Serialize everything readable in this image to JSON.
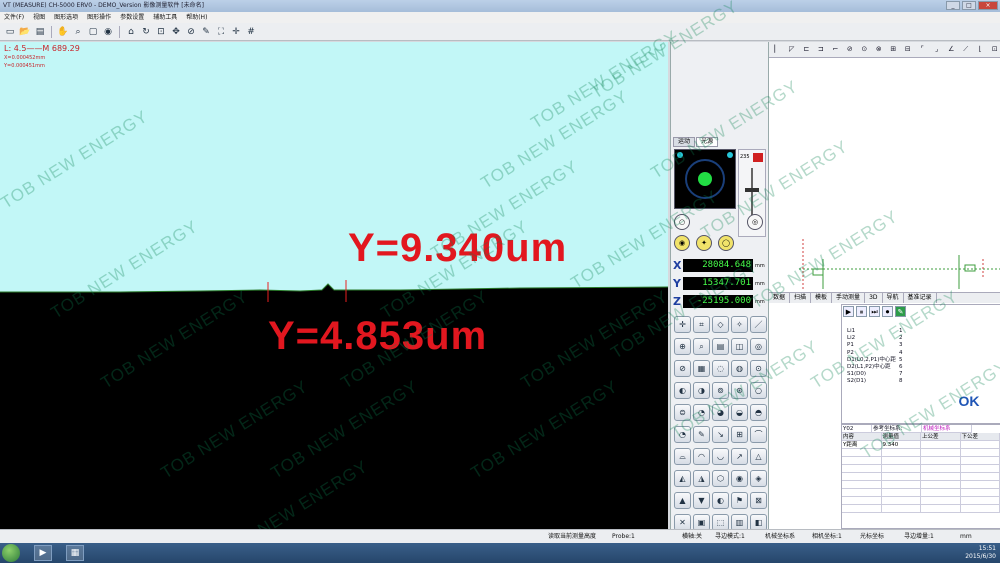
{
  "window": {
    "title": "VT (MEASURE) CH-5000 ERV0 - DEMO_Version 影像测量软件 [未命名]",
    "controls": [
      "_",
      "□",
      "×"
    ]
  },
  "menu": [
    "文件(F)",
    "视图",
    "图形选项",
    "图形操作",
    "参数设置",
    "辅助工具",
    "帮助(H)"
  ],
  "toolbar": [
    {
      "name": "new-icon",
      "glyph": "▭"
    },
    {
      "name": "open-icon",
      "glyph": "📂"
    },
    {
      "name": "save-icon",
      "glyph": "▤"
    },
    {
      "name": "sep"
    },
    {
      "name": "hand-icon",
      "glyph": "✋"
    },
    {
      "name": "zoom-icon",
      "glyph": "⌕"
    },
    {
      "name": "screen-icon",
      "glyph": "▢"
    },
    {
      "name": "eye-icon",
      "glyph": "◉"
    },
    {
      "name": "sep"
    },
    {
      "name": "home-icon",
      "glyph": "⌂"
    },
    {
      "name": "rotate-icon",
      "glyph": "↻"
    },
    {
      "name": "fit-icon",
      "glyph": "⊡"
    },
    {
      "name": "pan-icon",
      "glyph": "✥"
    },
    {
      "name": "stop-icon",
      "glyph": "⊘"
    },
    {
      "name": "tool-icon",
      "glyph": "✎"
    },
    {
      "name": "expand-icon",
      "glyph": "⛶"
    },
    {
      "name": "crosshair-icon",
      "glyph": "✛"
    },
    {
      "name": "grid-icon",
      "glyph": "#"
    }
  ],
  "readout": {
    "line1": "L: 4.5——M 689.29",
    "x": "X=0.000452mm",
    "y": "Y=0.000451mm"
  },
  "measurements": {
    "upper": "Y=9.340um",
    "lower": "Y=4.853um"
  },
  "watermark": "TOB NEW ENERGY",
  "control_panel": {
    "tabs": [
      "运动",
      "光源"
    ],
    "coords": [
      {
        "axis": "X",
        "value": "28084.648",
        "unit": "mm"
      },
      {
        "axis": "Y",
        "value": "15347.701",
        "unit": "mm"
      },
      {
        "axis": "Z",
        "value": "-25195.000",
        "unit": "mm"
      }
    ],
    "slider_value": "235"
  },
  "right_tabs": [
    "数据",
    "扫描",
    "模板",
    "手动测量",
    "3D",
    "导航",
    "基准记录"
  ],
  "feature_list": [
    {
      "name": "Li1",
      "num": "1"
    },
    {
      "name": "Li2",
      "num": "2"
    },
    {
      "name": "P1",
      "num": "3"
    },
    {
      "name": "P2",
      "num": "4"
    },
    {
      "name": "D1(L0,2,P1)中心距",
      "num": "5"
    },
    {
      "name": "D2(L1,P2)中心距",
      "num": "6"
    },
    {
      "name": "S1(D0)",
      "num": "7"
    },
    {
      "name": "S2(D1)",
      "num": "8"
    }
  ],
  "ok_label": "OK",
  "results": {
    "header1": [
      "Y02",
      "参考坐标系:",
      "机械坐标系"
    ],
    "columns": [
      "内容",
      "测量值",
      "上公差",
      "下公差"
    ],
    "rows": [
      [
        "Y距离",
        "9.340",
        "",
        ""
      ]
    ]
  },
  "status": {
    "left": "坐标系",
    "probe": "Probe:1",
    "mid": "读取当前测量高度",
    "items": [
      "横轴:关",
      "寻边模式:1",
      "机械坐标系",
      "相机坐标:1",
      "光标坐标",
      "寻边增量:1",
      "mm"
    ]
  },
  "taskbar": {
    "time": "15:51",
    "date": "2015/6/30"
  }
}
